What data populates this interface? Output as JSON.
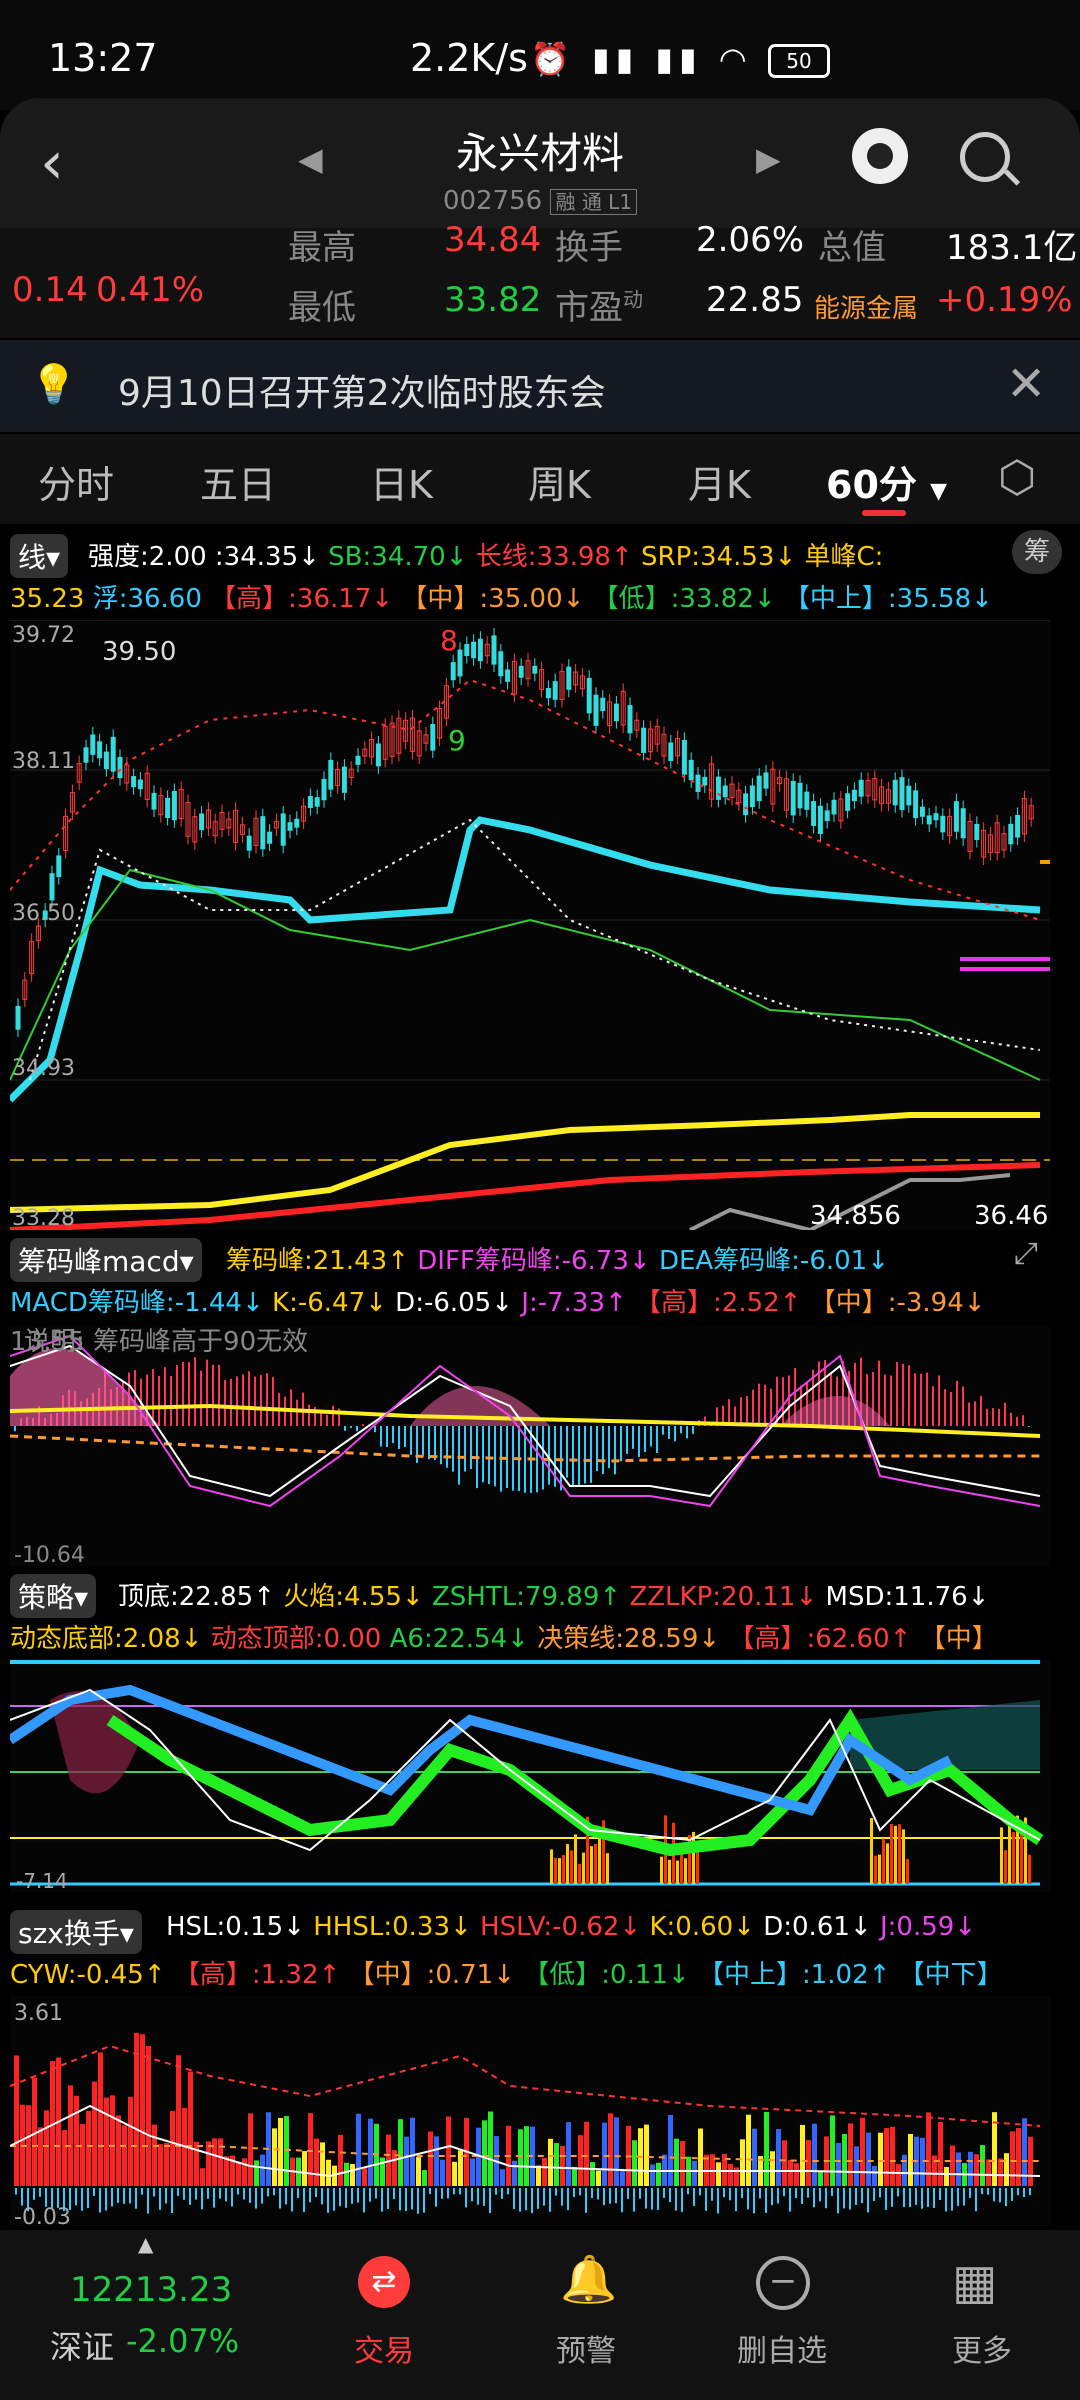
{
  "status": {
    "time": "13:27",
    "speed": "2.2K/s",
    "battery": "50"
  },
  "header": {
    "title": "永兴材料",
    "code": "002756",
    "tags": "融 通 L1"
  },
  "quote": {
    "change": "0.14",
    "change_pct": "0.41%",
    "high_label": "最高",
    "high_value": "34.84",
    "low_label": "最低",
    "low_value": "33.82",
    "turnover_label": "换手",
    "turnover_value": "2.06%",
    "pe_label": "市盈",
    "pe_sup": "动",
    "pe_value": "22.85",
    "mcap_label": "总值",
    "mcap_value": "183.1亿",
    "sector_label": "能源金属",
    "sector_value": "+0.19%"
  },
  "notice": {
    "text": "9月10日召开第2次临时股东会"
  },
  "tabs": [
    "分时",
    "五日",
    "日K",
    "周K",
    "月K",
    "60分"
  ],
  "chart1": {
    "selector": "线",
    "line1": [
      {
        "t": "强度:2.00",
        "c": "white"
      },
      {
        "t": ":34.35↓",
        "c": "white"
      },
      {
        "t": "SB:34.70↓",
        "c": "green"
      },
      {
        "t": "长线:33.98↑",
        "c": "red"
      },
      {
        "t": "SRP:34.53↓",
        "c": "yellow"
      },
      {
        "t": "单峰C:",
        "c": "yellow"
      }
    ],
    "line2": [
      {
        "t": "35.23",
        "c": "yellow"
      },
      {
        "t": "浮:36.60",
        "c": "cyan"
      },
      {
        "t": "【高】:36.17↓",
        "c": "red"
      },
      {
        "t": "【中】:35.00↓",
        "c": "orange"
      },
      {
        "t": "【低】:33.82↓",
        "c": "green"
      },
      {
        "t": "【中上】:35.58↓",
        "c": "cyan"
      }
    ],
    "corner_btn": "筹",
    "ymax": "39.72",
    "ymin": "33.28",
    "y1": "38.11",
    "y2": "36.50",
    "y3": "34.93",
    "peak_label": "39.50",
    "label_a": "34.856",
    "label_b": "36.467",
    "mark8": "8",
    "mark9": "9"
  },
  "chart2": {
    "selector": "筹码峰macd",
    "line1": [
      {
        "t": "筹码峰:21.43↑",
        "c": "yellow"
      },
      {
        "t": "DIFF筹码峰:-6.73↓",
        "c": "magenta"
      },
      {
        "t": "DEA筹码峰:-6.01↓",
        "c": "cyan"
      }
    ],
    "line2": [
      {
        "t": "MACD筹码峰:-1.44↓",
        "c": "cyan"
      },
      {
        "t": "K:-6.47↓",
        "c": "yellow"
      },
      {
        "t": "D:-6.05↓",
        "c": "white"
      },
      {
        "t": "J:-7.33↑",
        "c": "magenta"
      },
      {
        "t": "【高】:2.52↑",
        "c": "red"
      },
      {
        "t": "【中】:-3.94↓",
        "c": "orange"
      }
    ],
    "note": "说明: 筹码峰高于90无效",
    "ymax": "13.55",
    "ymin": "-10.64"
  },
  "chart3": {
    "selector": "策略",
    "line1": [
      {
        "t": "顶底:22.85↑",
        "c": "white"
      },
      {
        "t": "火焰:4.55↓",
        "c": "yellow"
      },
      {
        "t": "ZSHTL:79.89↑",
        "c": "green"
      },
      {
        "t": "ZZLKP:20.11↓",
        "c": "red"
      },
      {
        "t": "MSD:11.76↓",
        "c": "white"
      }
    ],
    "line2": [
      {
        "t": "动态底部:2.08↓",
        "c": "yellow"
      },
      {
        "t": "动态顶部:0.00",
        "c": "red"
      },
      {
        "t": "A6:22.54↓",
        "c": "green"
      },
      {
        "t": "决策线:28.59↓",
        "c": "orange"
      },
      {
        "t": "【高】:62.60↑",
        "c": "red"
      },
      {
        "t": "【中】",
        "c": "orange"
      }
    ],
    "ymin": "-7.14"
  },
  "chart4": {
    "selector": "szx换手",
    "line1": [
      {
        "t": "HSL:0.15↓",
        "c": "white"
      },
      {
        "t": "HHSL:0.33↓",
        "c": "yellow"
      },
      {
        "t": "HSLV:-0.62↓",
        "c": "red"
      },
      {
        "t": "K:0.60↓",
        "c": "yellow"
      },
      {
        "t": "D:0.61↓",
        "c": "white"
      },
      {
        "t": "J:0.59↓",
        "c": "magenta"
      }
    ],
    "line2": [
      {
        "t": "CYW:-0.45↑",
        "c": "yellow"
      },
      {
        "t": "【高】:1.32↑",
        "c": "red"
      },
      {
        "t": "【中】:0.71↓",
        "c": "orange"
      },
      {
        "t": "【低】:0.11↓",
        "c": "green"
      },
      {
        "t": "【中上】:1.02↑",
        "c": "cyan"
      },
      {
        "t": "【中下】",
        "c": "cyan"
      }
    ],
    "ymax": "3.61",
    "ymin": "-0.03"
  },
  "nav": {
    "index_value": "12213.23",
    "index_name": "深证",
    "index_change": "-2.07%",
    "items": [
      "交易",
      "预警",
      "删自选",
      "更多"
    ]
  }
}
